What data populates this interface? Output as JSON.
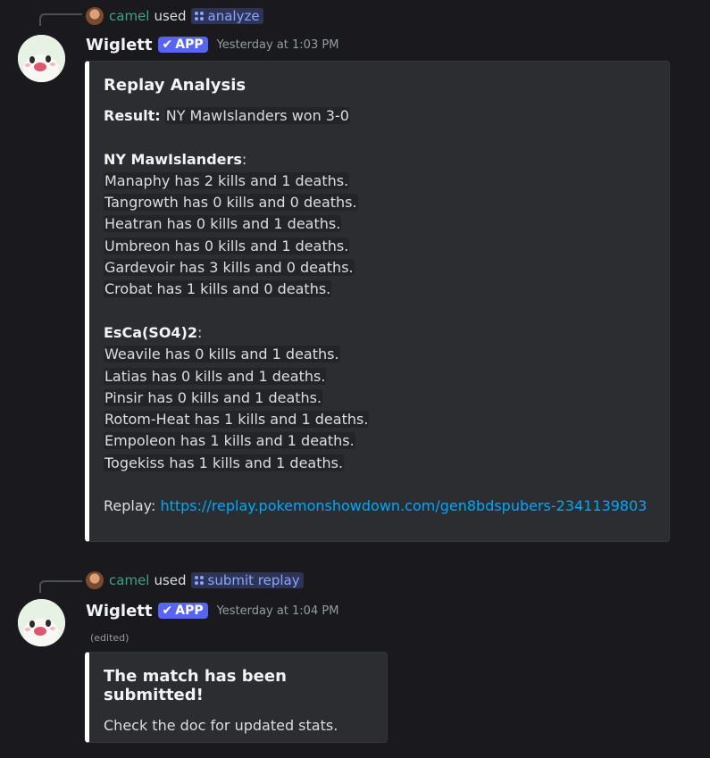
{
  "messages": [
    {
      "reply": {
        "user": "camel",
        "used": "used",
        "command": "analyze"
      },
      "author": "Wiglett",
      "badge": "APP",
      "timestamp": "Yesterday at 1:03 PM",
      "embed": {
        "title": "Replay Analysis",
        "result_label": "Result:",
        "result_value": "NY MawIslanders won 3-0",
        "team1": {
          "name": "NY MawIslanders",
          "lines": [
            "Manaphy has 2 kills and 1 deaths.",
            "Tangrowth has 0 kills and 0 deaths.",
            "Heatran has 0 kills and 1 deaths.",
            "Umbreon has 0 kills and 1 deaths.",
            "Gardevoir has 3 kills and 0 deaths.",
            "Crobat has 1 kills and 0 deaths."
          ]
        },
        "team2": {
          "name": "EsCa(SO4)2",
          "lines": [
            "Weavile has 0 kills and 1 deaths.",
            "Latias has 0 kills and 1 deaths.",
            "Pinsir has 0 kills and 1 deaths.",
            "Rotom-Heat has 1 kills and 1 deaths.",
            "Empoleon has 1 kills and 1 deaths.",
            "Togekiss has 1 kills and 1 deaths."
          ]
        },
        "replay_label": "Replay:",
        "replay_url": "https://replay.pokemonshowdown.com/gen8bdspubers-2341139803"
      }
    },
    {
      "reply": {
        "user": "camel",
        "used": "used",
        "command": "submit replay"
      },
      "author": "Wiglett",
      "badge": "APP",
      "timestamp": "Yesterday at 1:04 PM",
      "edited": "(edited)",
      "embed": {
        "title": "The match has been submitted!",
        "description": "Check the doc for updated stats."
      }
    }
  ],
  "colors": {
    "background": "#1a1a1e",
    "embed_bg": "#2b2d31",
    "accent": "#5865f2",
    "link": "#00a8fc",
    "reply_user": "#3aa28a"
  }
}
